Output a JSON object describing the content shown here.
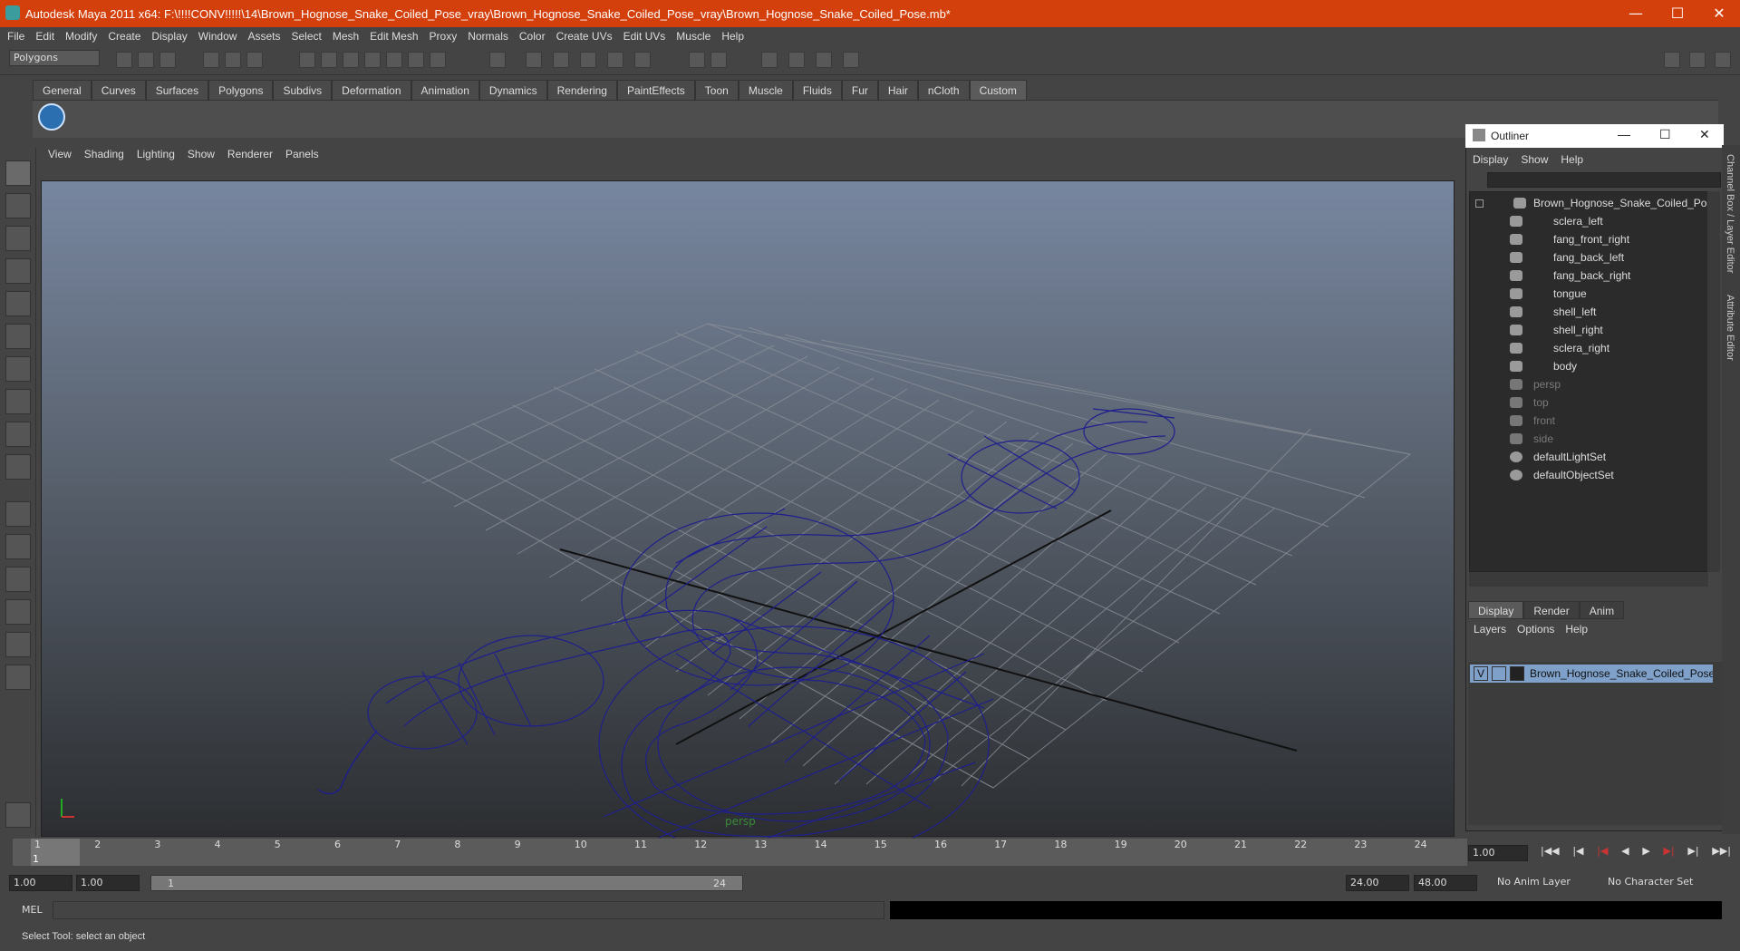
{
  "window": {
    "title": "Autodesk Maya 2011 x64: F:\\!!!!CONV!!!!!\\14\\Brown_Hognose_Snake_Coiled_Pose_vray\\Brown_Hognose_Snake_Coiled_Pose_vray\\Brown_Hognose_Snake_Coiled_Pose.mb*"
  },
  "menubar": [
    "File",
    "Edit",
    "Modify",
    "Create",
    "Display",
    "Window",
    "Assets",
    "Select",
    "Mesh",
    "Edit Mesh",
    "Proxy",
    "Normals",
    "Color",
    "Create UVs",
    "Edit UVs",
    "Muscle",
    "Help"
  ],
  "mode_selector": "Polygons",
  "shelf_tabs": [
    "General",
    "Curves",
    "Surfaces",
    "Polygons",
    "Subdivs",
    "Deformation",
    "Animation",
    "Dynamics",
    "Rendering",
    "PaintEffects",
    "Toon",
    "Muscle",
    "Fluids",
    "Fur",
    "Hair",
    "nCloth",
    "Custom"
  ],
  "active_shelf": "Custom",
  "viewport": {
    "menu": [
      "View",
      "Shading",
      "Lighting",
      "Show",
      "Renderer",
      "Panels"
    ],
    "camera": "persp",
    "wire_color": "#1f1f8c"
  },
  "outliner": {
    "title": "Outliner",
    "menu": [
      "Display",
      "Show",
      "Help"
    ],
    "items": [
      {
        "label": "Brown_Hognose_Snake_Coiled_Pose",
        "indent": 0,
        "dim": false
      },
      {
        "label": "sclera_left",
        "indent": 1,
        "dim": false
      },
      {
        "label": "fang_front_right",
        "indent": 1,
        "dim": false
      },
      {
        "label": "fang_back_left",
        "indent": 1,
        "dim": false
      },
      {
        "label": "fang_back_right",
        "indent": 1,
        "dim": false
      },
      {
        "label": "tongue",
        "indent": 1,
        "dim": false
      },
      {
        "label": "shell_left",
        "indent": 1,
        "dim": false
      },
      {
        "label": "shell_right",
        "indent": 1,
        "dim": false
      },
      {
        "label": "sclera_right",
        "indent": 1,
        "dim": false
      },
      {
        "label": "body",
        "indent": 1,
        "dim": false
      },
      {
        "label": "persp",
        "indent": 0,
        "dim": true
      },
      {
        "label": "top",
        "indent": 0,
        "dim": true
      },
      {
        "label": "front",
        "indent": 0,
        "dim": true
      },
      {
        "label": "side",
        "indent": 0,
        "dim": true
      },
      {
        "label": "defaultLightSet",
        "indent": 0,
        "dim": false
      },
      {
        "label": "defaultObjectSet",
        "indent": 0,
        "dim": false
      }
    ]
  },
  "layer_editor": {
    "tabs": [
      "Display",
      "Render",
      "Anim"
    ],
    "menu": [
      "Layers",
      "Options",
      "Help"
    ],
    "layer": {
      "visible": "V",
      "name": "Brown_Hognose_Snake_Coiled_Pose_layer"
    }
  },
  "side_tabs": [
    "Channel Box / Layer Editor",
    "Attribute Editor"
  ],
  "timeline": {
    "frames": [
      "1",
      "2",
      "3",
      "4",
      "5",
      "6",
      "7",
      "8",
      "9",
      "10",
      "11",
      "12",
      "13",
      "14",
      "15",
      "16",
      "17",
      "18",
      "19",
      "20",
      "21",
      "22",
      "23",
      "24"
    ],
    "current_label": "1",
    "current": "1.00"
  },
  "range": {
    "start_time": "1.00",
    "start_playback": "1.00",
    "slider_start": "1",
    "slider_end": "24",
    "end_playback": "24.00",
    "end_time": "48.00",
    "anim_layer": "No Anim Layer",
    "char_set": "No Character Set"
  },
  "command_line": {
    "label": "MEL"
  },
  "help_line": "Select Tool: select an object"
}
